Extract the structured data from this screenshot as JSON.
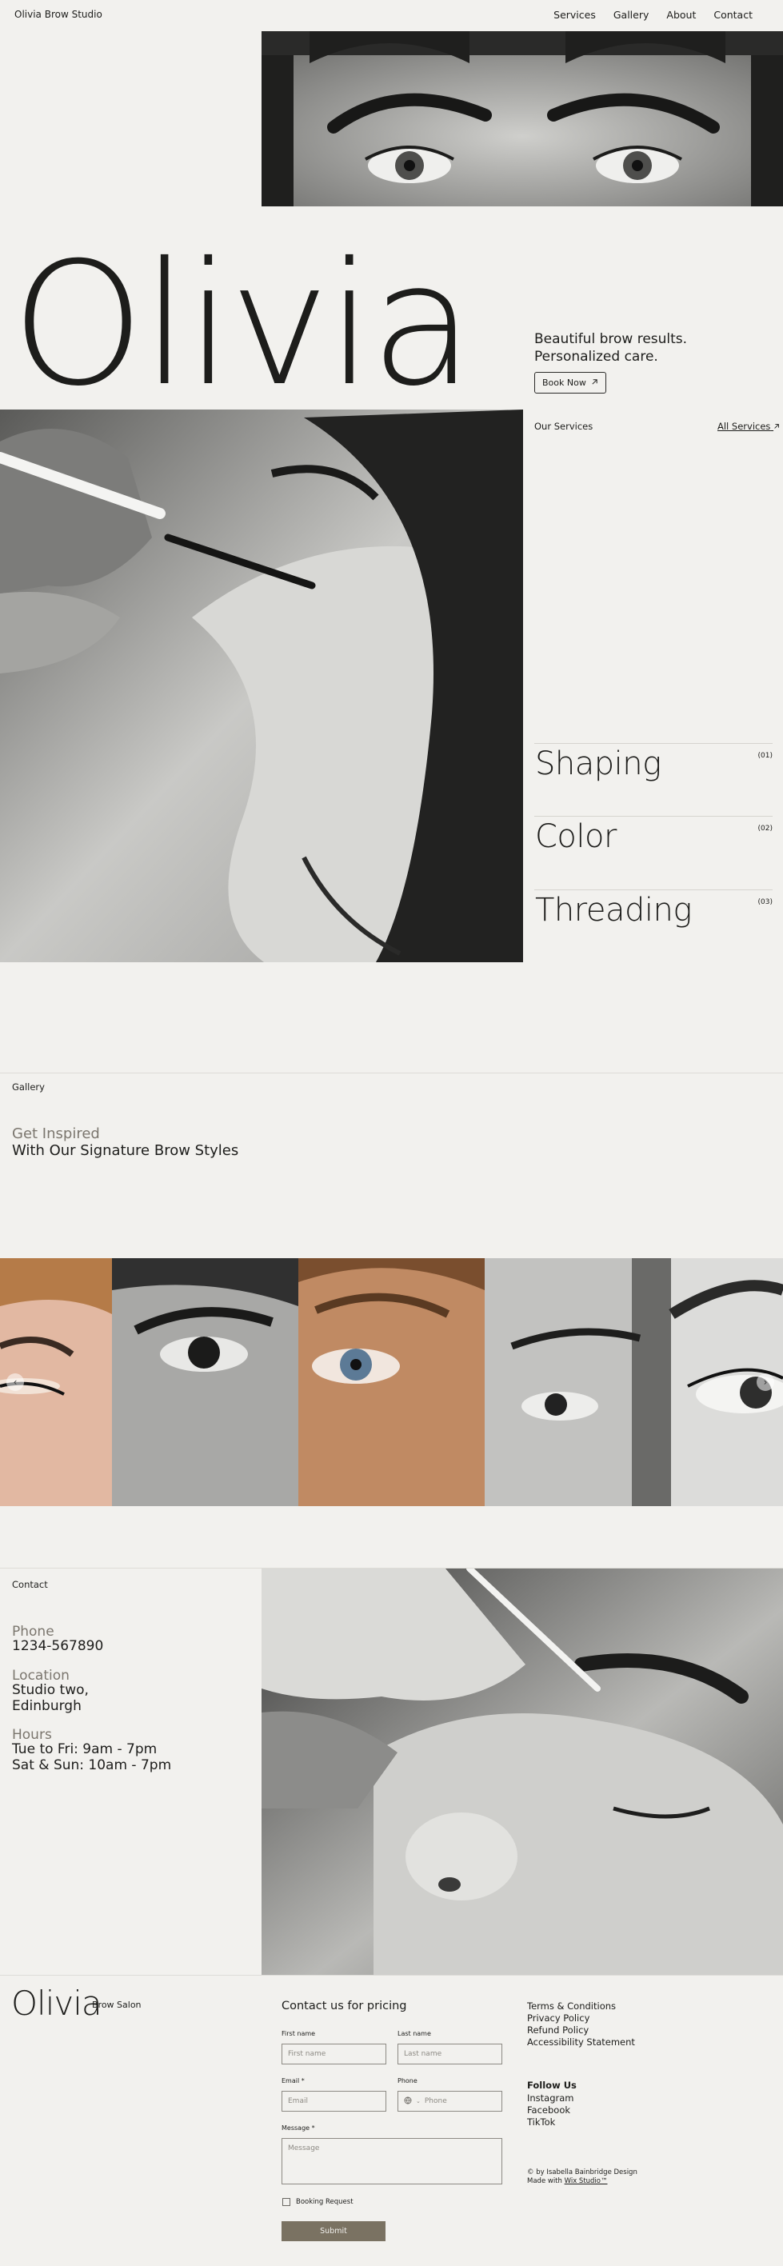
{
  "header": {
    "brand": "Olivia Brow Studio",
    "nav": [
      "Services",
      "Gallery",
      "About",
      "Contact"
    ]
  },
  "hero": {
    "title": "Olivia",
    "tagline_line1": "Beautiful brow results.",
    "tagline_line2": "Personalized care.",
    "book_button": "Book Now",
    "book_icon": "arrow-up-right-icon"
  },
  "services": {
    "label": "Our Services",
    "all_link": "All Services",
    "items": [
      {
        "name": "Shaping",
        "num": "(01)"
      },
      {
        "name": "Color",
        "num": "(02)"
      },
      {
        "name": "Threading",
        "num": "(03)"
      }
    ]
  },
  "gallery": {
    "label": "Gallery",
    "heading1": "Get Inspired",
    "heading2": "With Our Signature Brow Styles",
    "prev_icon": "chevron-left-icon",
    "next_icon": "chevron-right-icon"
  },
  "contact": {
    "label": "Contact",
    "phone_label": "Phone",
    "phone": "1234-567890",
    "location_label": "Location",
    "location_line1": "Studio two,",
    "location_line2": "Edinburgh",
    "hours_label": "Hours",
    "hours_line1": "Tue to Fri: 9am - 7pm",
    "hours_line2": "Sat & Sun: 10am - 7pm"
  },
  "footer": {
    "logo": "Olivia",
    "logo_sub": "Brow Salon",
    "form": {
      "title": "Contact us for pricing",
      "first_name_label": "First name",
      "first_name_placeholder": "First name",
      "last_name_label": "Last name",
      "last_name_placeholder": "Last name",
      "email_label": "Email *",
      "email_placeholder": "Email",
      "phone_label": "Phone",
      "phone_placeholder": "Phone",
      "message_label": "Message *",
      "message_placeholder": "Message",
      "checkbox_label": "Booking Request",
      "submit": "Submit"
    },
    "links": [
      "Terms & Conditions",
      "Privacy Policy",
      "Refund Policy",
      "Accessibility Statement"
    ],
    "follow_label": "Follow Us",
    "social": [
      "Instagram",
      "Facebook",
      "TikTok"
    ],
    "credit_line1": "© by Isabella Bainbridge Design",
    "credit_made": "Made with",
    "credit_link": "Wix Studio™"
  },
  "colors": {
    "background": "#f2f1ee",
    "text": "#1d1d1b",
    "muted": "#7b766e",
    "submit_button": "#7a7262"
  }
}
